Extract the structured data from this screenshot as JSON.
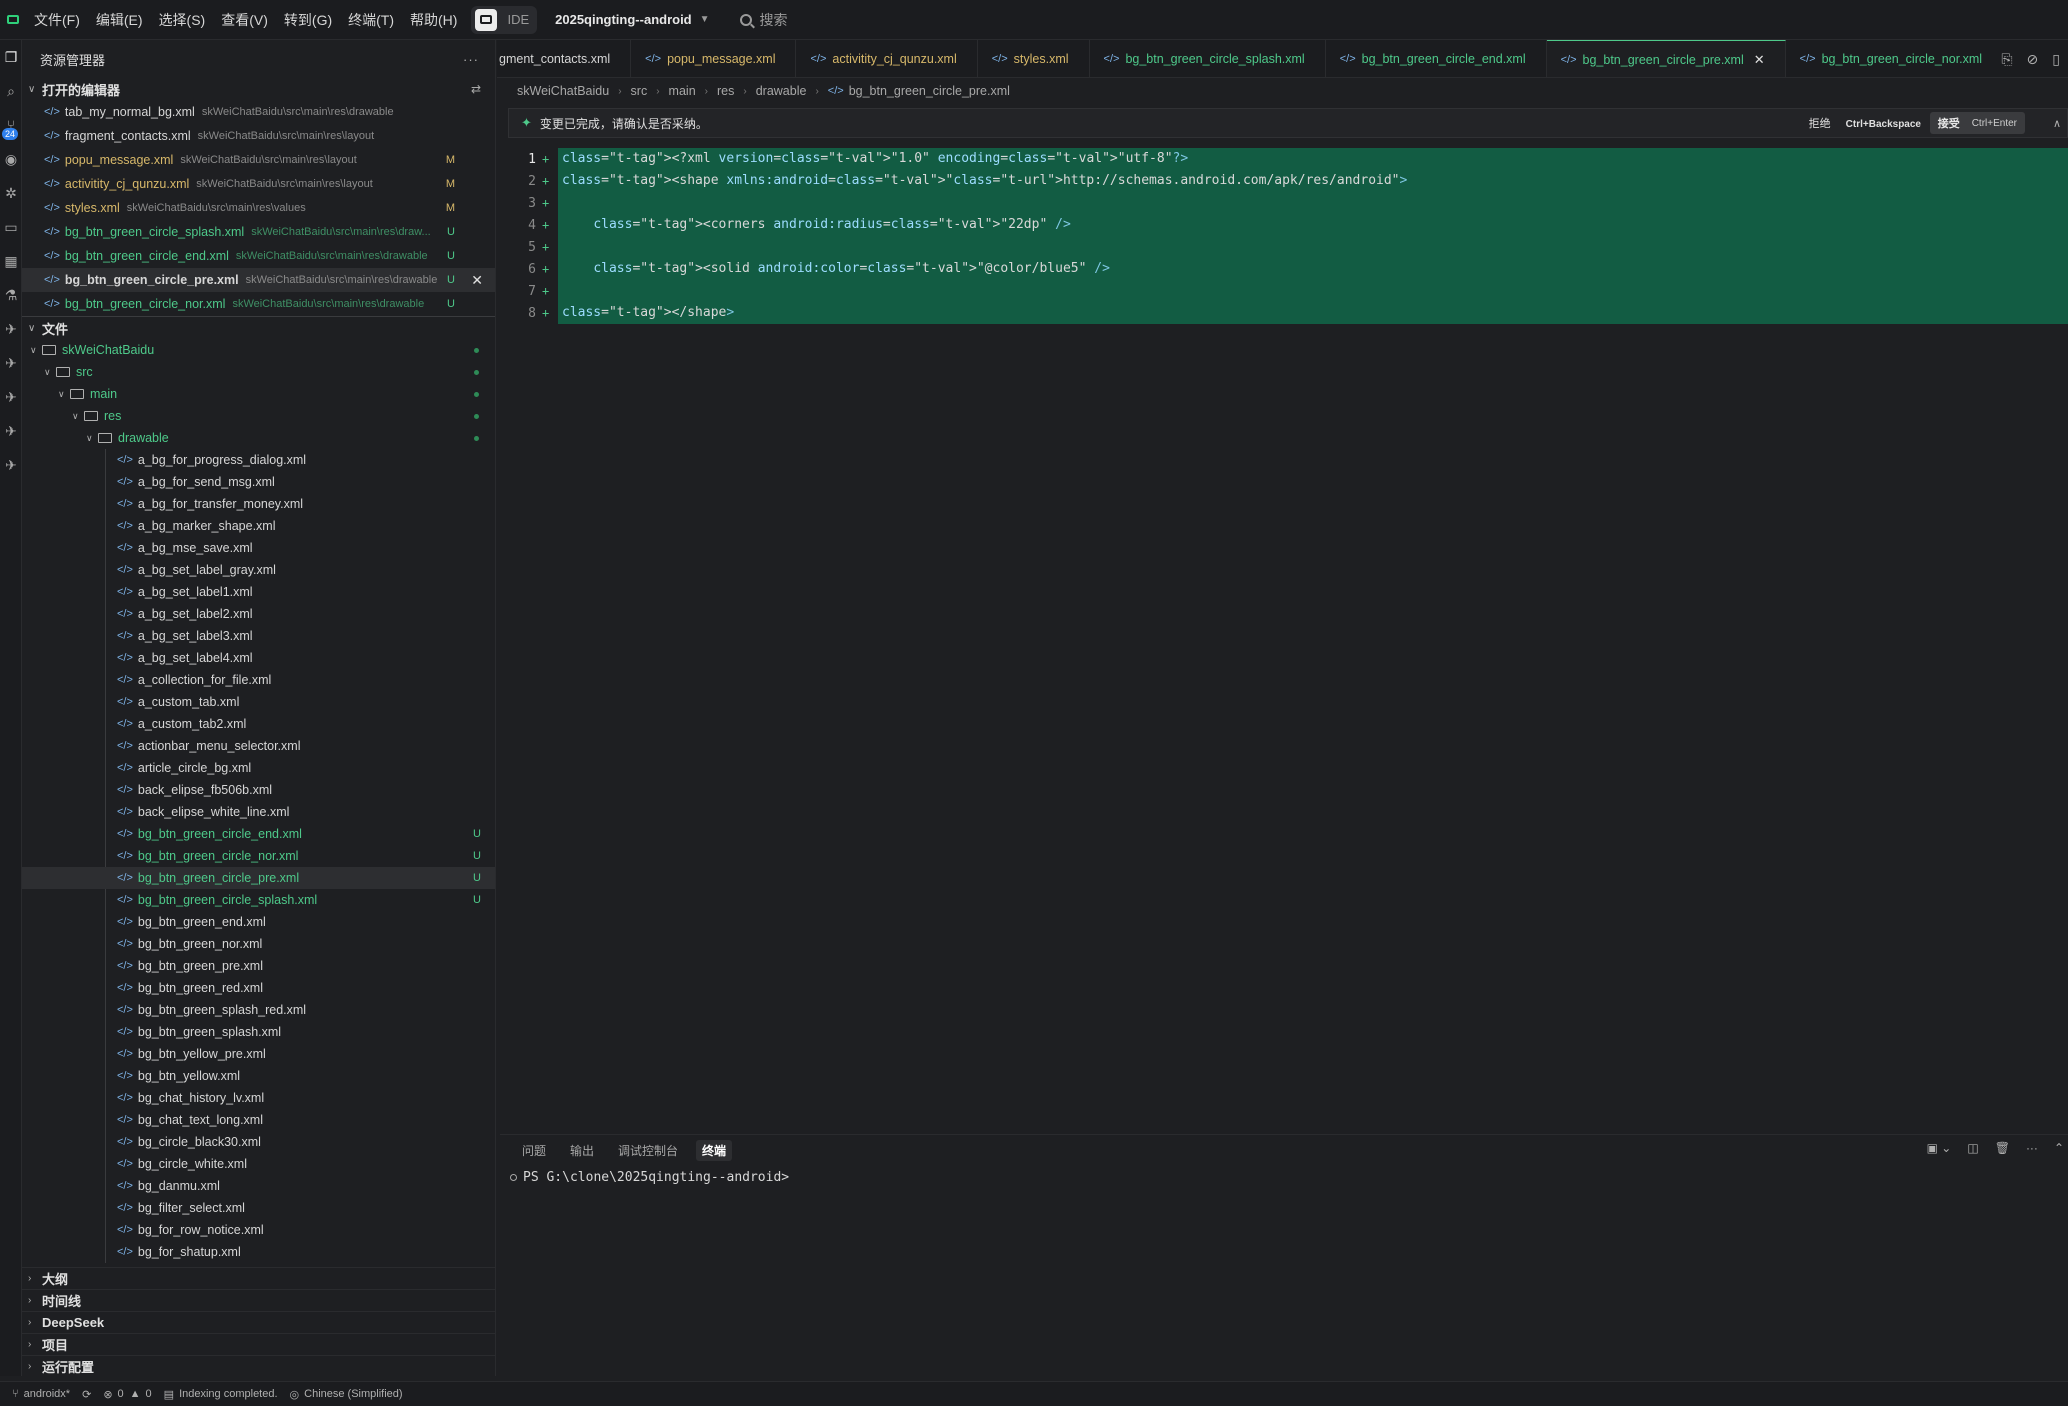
{
  "menu": [
    "文件(F)",
    "编辑(E)",
    "选择(S)",
    "查看(V)",
    "转到(G)",
    "终端(T)",
    "帮助(H)"
  ],
  "ide_label": "IDE",
  "project_name": "2025qingting--android",
  "search_placeholder": "搜索",
  "activity_badge": "24",
  "explorer_title": "资源管理器",
  "open_editors": {
    "title": "打开的编辑器",
    "items": [
      {
        "name": "tab_my_normal_bg.xml",
        "path": "skWeiChatBaidu\\src\\main\\res\\drawable",
        "status": "",
        "color": "white"
      },
      {
        "name": "fragment_contacts.xml",
        "path": "skWeiChatBaidu\\src\\main\\res\\layout",
        "status": "",
        "color": "white"
      },
      {
        "name": "popu_message.xml",
        "path": "skWeiChatBaidu\\src\\main\\res\\layout",
        "status": "M",
        "color": "yellow"
      },
      {
        "name": "activitity_cj_qunzu.xml",
        "path": "skWeiChatBaidu\\src\\main\\res\\layout",
        "status": "M",
        "color": "yellow"
      },
      {
        "name": "styles.xml",
        "path": "skWeiChatBaidu\\src\\main\\res\\values",
        "status": "M",
        "color": "yellow"
      },
      {
        "name": "bg_btn_green_circle_splash.xml",
        "path": "skWeiChatBaidu\\src\\main\\res\\draw...",
        "status": "U",
        "color": "green"
      },
      {
        "name": "bg_btn_green_circle_end.xml",
        "path": "skWeiChatBaidu\\src\\main\\res\\drawable",
        "status": "U",
        "color": "green"
      },
      {
        "name": "bg_btn_green_circle_pre.xml",
        "path": "skWeiChatBaidu\\src\\main\\res\\drawable",
        "status": "U",
        "color": "white",
        "selected": true
      },
      {
        "name": "bg_btn_green_circle_nor.xml",
        "path": "skWeiChatBaidu\\src\\main\\res\\drawable",
        "status": "U",
        "color": "green"
      }
    ]
  },
  "files_section": {
    "title": "文件",
    "folders": [
      "skWeiChatBaidu",
      "src",
      "main",
      "res",
      "drawable"
    ],
    "files": [
      {
        "name": "a_bg_for_progress_dialog.xml",
        "status": ""
      },
      {
        "name": "a_bg_for_send_msg.xml",
        "status": ""
      },
      {
        "name": "a_bg_for_transfer_money.xml",
        "status": ""
      },
      {
        "name": "a_bg_marker_shape.xml",
        "status": ""
      },
      {
        "name": "a_bg_mse_save.xml",
        "status": ""
      },
      {
        "name": "a_bg_set_label_gray.xml",
        "status": ""
      },
      {
        "name": "a_bg_set_label1.xml",
        "status": ""
      },
      {
        "name": "a_bg_set_label2.xml",
        "status": ""
      },
      {
        "name": "a_bg_set_label3.xml",
        "status": ""
      },
      {
        "name": "a_bg_set_label4.xml",
        "status": ""
      },
      {
        "name": "a_collection_for_file.xml",
        "status": ""
      },
      {
        "name": "a_custom_tab.xml",
        "status": ""
      },
      {
        "name": "a_custom_tab2.xml",
        "status": ""
      },
      {
        "name": "actionbar_menu_selector.xml",
        "status": ""
      },
      {
        "name": "article_circle_bg.xml",
        "status": ""
      },
      {
        "name": "back_elipse_fb506b.xml",
        "status": ""
      },
      {
        "name": "back_elipse_white_line.xml",
        "status": ""
      },
      {
        "name": "bg_btn_green_circle_end.xml",
        "status": "U"
      },
      {
        "name": "bg_btn_green_circle_nor.xml",
        "status": "U"
      },
      {
        "name": "bg_btn_green_circle_pre.xml",
        "status": "U",
        "selected": true
      },
      {
        "name": "bg_btn_green_circle_splash.xml",
        "status": "U"
      },
      {
        "name": "bg_btn_green_end.xml",
        "status": ""
      },
      {
        "name": "bg_btn_green_nor.xml",
        "status": ""
      },
      {
        "name": "bg_btn_green_pre.xml",
        "status": ""
      },
      {
        "name": "bg_btn_green_red.xml",
        "status": ""
      },
      {
        "name": "bg_btn_green_splash_red.xml",
        "status": ""
      },
      {
        "name": "bg_btn_green_splash.xml",
        "status": ""
      },
      {
        "name": "bg_btn_yellow_pre.xml",
        "status": ""
      },
      {
        "name": "bg_btn_yellow.xml",
        "status": ""
      },
      {
        "name": "bg_chat_history_lv.xml",
        "status": ""
      },
      {
        "name": "bg_chat_text_long.xml",
        "status": ""
      },
      {
        "name": "bg_circle_black30.xml",
        "status": ""
      },
      {
        "name": "bg_circle_white.xml",
        "status": ""
      },
      {
        "name": "bg_danmu.xml",
        "status": ""
      },
      {
        "name": "bg_filter_select.xml",
        "status": ""
      },
      {
        "name": "bg_for_row_notice.xml",
        "status": ""
      },
      {
        "name": "bg_for_shatup.xml",
        "status": ""
      }
    ]
  },
  "bottom_sections": [
    "大纲",
    "时间线",
    "DeepSeek",
    "项目",
    "运行配置"
  ],
  "tabs": [
    {
      "name": "gment_contacts.xml",
      "color": "white"
    },
    {
      "name": "popu_message.xml",
      "color": "yellow"
    },
    {
      "name": "activitity_cj_qunzu.xml",
      "color": "yellow"
    },
    {
      "name": "styles.xml",
      "color": "yellow"
    },
    {
      "name": "bg_btn_green_circle_splash.xml",
      "color": "green"
    },
    {
      "name": "bg_btn_green_circle_end.xml",
      "color": "green"
    },
    {
      "name": "bg_btn_green_circle_pre.xml",
      "color": "green",
      "active": true
    },
    {
      "name": "bg_btn_green_circle_nor.xml",
      "color": "green"
    }
  ],
  "breadcrumb": [
    "skWeiChatBaidu",
    "src",
    "main",
    "res",
    "drawable",
    "bg_btn_green_circle_pre.xml"
  ],
  "notice": {
    "text": "变更已完成，请确认是否采纳。",
    "reject_label": "拒绝",
    "reject_shortcut": "Ctrl+Backspace",
    "accept_label": "接受",
    "accept_shortcut": "Ctrl+Enter"
  },
  "code_lines": [
    "<?xml version=\"1.0\" encoding=\"utf-8\"?>",
    "<shape xmlns:android=\"http://schemas.android.com/apk/res/android\">",
    "",
    "    <corners android:radius=\"22dp\" />",
    "",
    "    <solid android:color=\"@color/blue5\" />",
    "",
    "</shape>"
  ],
  "panel": {
    "tabs": [
      "问题",
      "输出",
      "调试控制台",
      "终端"
    ],
    "active_tab": "终端",
    "terminal_prompt": "PS G:\\clone\\2025qingting--android>"
  },
  "status": {
    "branch": "androidx*",
    "errors": "0",
    "warnings": "0",
    "indexing": "Indexing completed.",
    "language": "Chinese (Simplified)"
  },
  "colors": {
    "accent_green": "#4ec98a",
    "diff_bg": "#125c43",
    "modified_yellow": "#d7b86a",
    "badge_blue": "#2f80ed"
  }
}
